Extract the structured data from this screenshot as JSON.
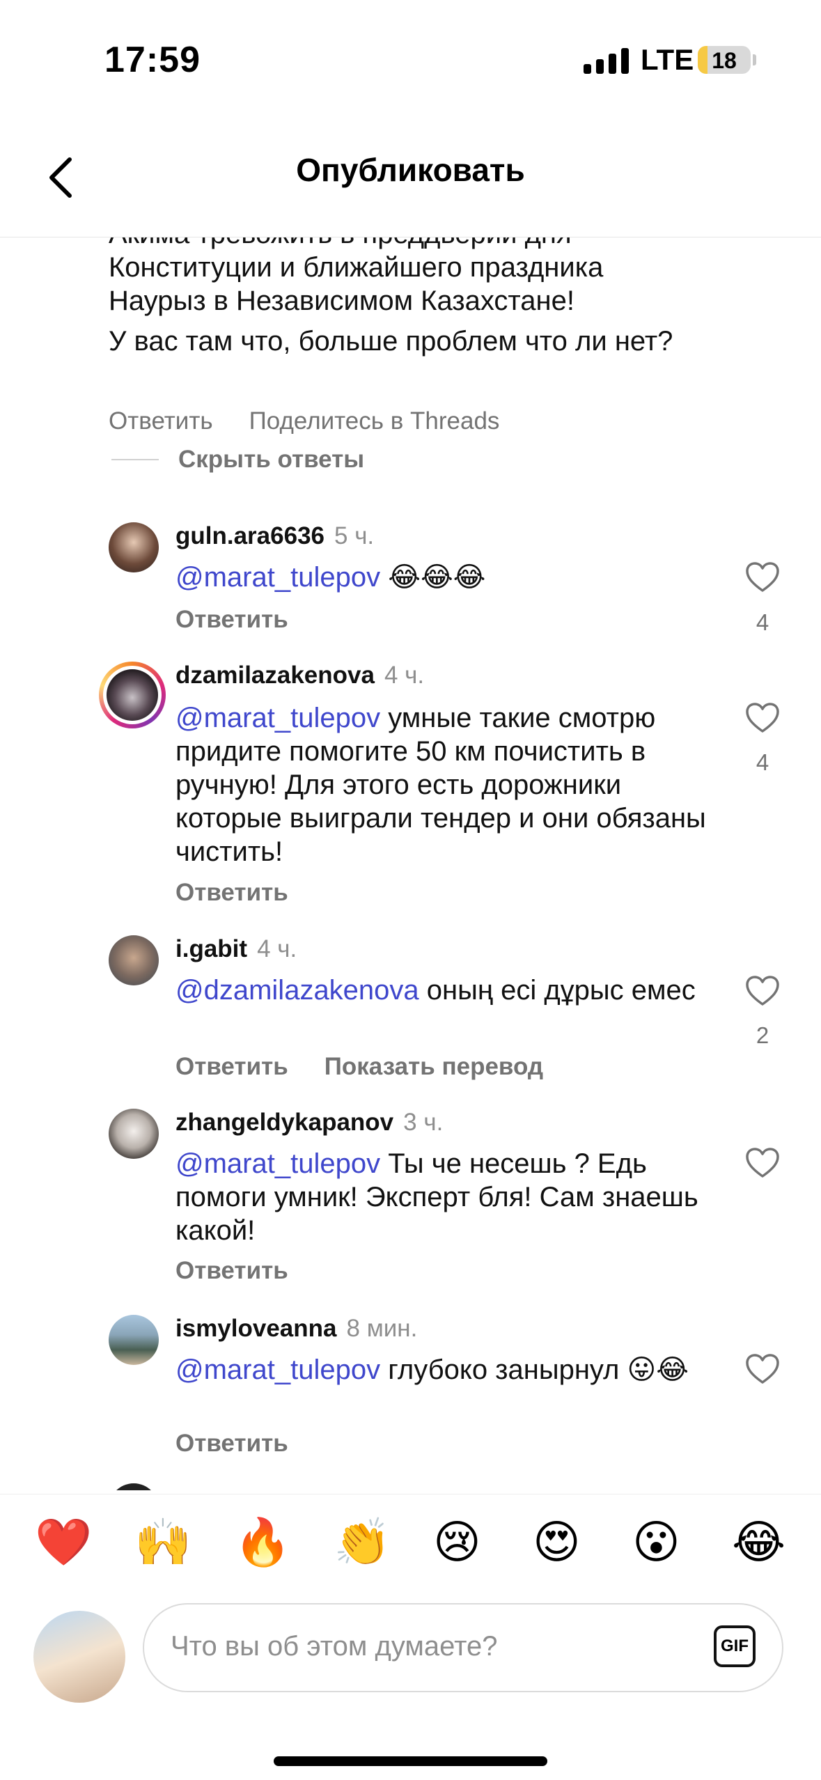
{
  "status_bar": {
    "time": "17:59",
    "network": "LTE",
    "battery": "18",
    "battery_level": 0.18
  },
  "header": {
    "title": "Опубликовать",
    "back_icon": "chevron-left-icon"
  },
  "post": {
    "text_lines_1": "Акима тревожить в преддверии дня Конституции и ближайшего праздника Наурыз в Независимом Казахстане!",
    "text_2": "У вас там что, больше проблем что ли нет?",
    "reply_label": "Ответить",
    "share_label": "Поделитесь в Threads",
    "hide_replies": "Скрыть ответы"
  },
  "comments": [
    {
      "username": "guln.ara6636",
      "time": "5 ч.",
      "mention": "@marat_tulepov",
      "text": " 😂😂😂",
      "likes": "4",
      "reply": "Ответить"
    },
    {
      "username": "dzamilazakenova",
      "time": "4 ч.",
      "mention": "@marat_tulepov",
      "text": " умные такие смотрю придите помогите 50 км почистить в ручную! Для этого есть дорожники которые выиграли тендер и они обязаны чистить!",
      "likes": "4",
      "reply": "Ответить"
    },
    {
      "username": "i.gabit",
      "time": "4 ч.",
      "mention": "@dzamilazakenova",
      "text": " оның есі дұрыс емес",
      "likes": "2",
      "reply": "Ответить",
      "translate": "Показать перевод"
    },
    {
      "username": "zhangeldykapanov",
      "time": "3 ч.",
      "mention": "@marat_tulepov",
      "text": " Ты че несешь ? Едь помоги умник! Эксперт бля! Сам знаешь какой!",
      "likes": "",
      "reply": "Ответить"
    },
    {
      "username": "ismyloveanna",
      "time": "8 мин.",
      "mention": "@marat_tulepov",
      "text": " глубоко занырнул 😛😂",
      "likes": "",
      "reply": "Ответить"
    }
  ],
  "reactions": [
    "❤️",
    "🙌",
    "🔥",
    "👏",
    "😢",
    "😍",
    "😮",
    "😂"
  ],
  "composer": {
    "placeholder": "Что вы об этом думаете?",
    "gif_label": "GIF"
  }
}
